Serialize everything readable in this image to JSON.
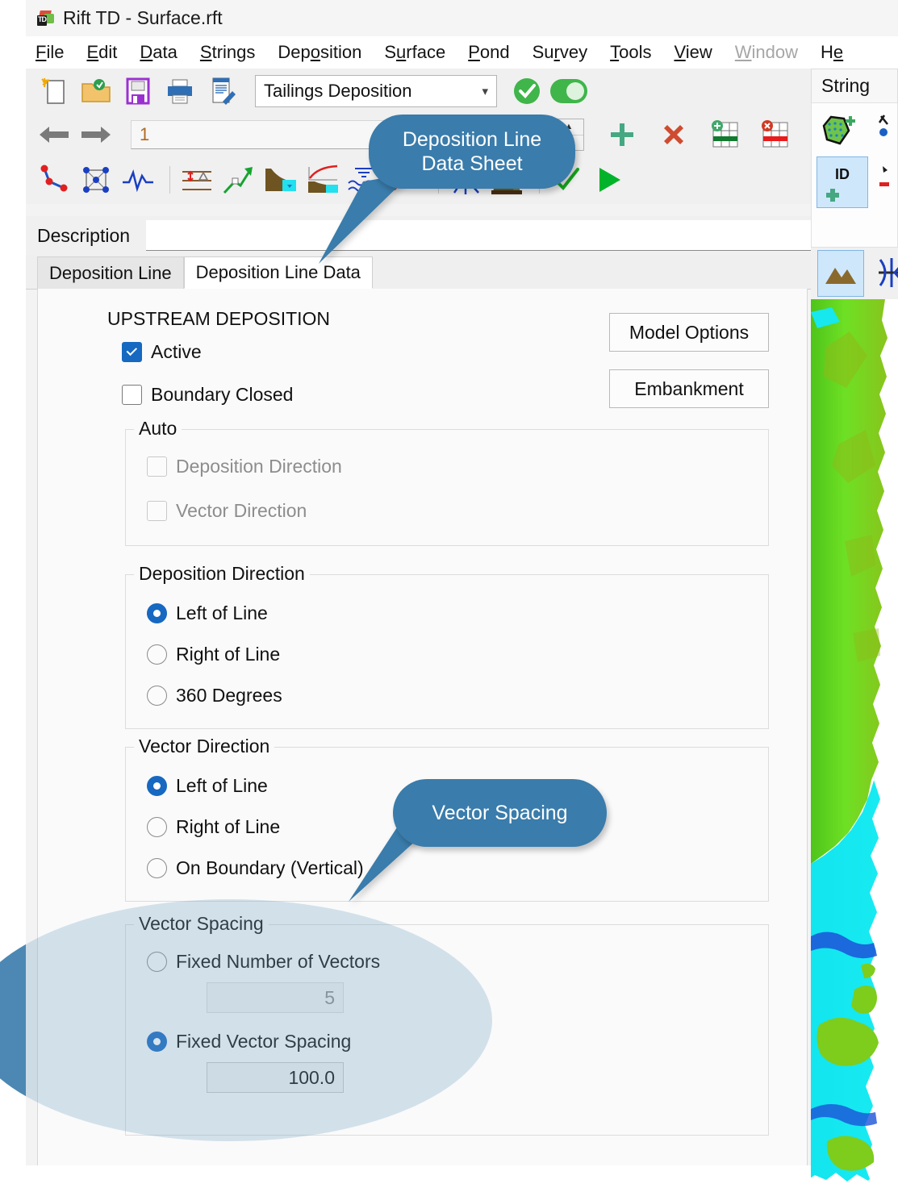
{
  "window": {
    "title": "Rift TD - Surface.rft",
    "icon": "app-icon"
  },
  "menu": [
    {
      "label": "File",
      "accel": "F",
      "disabled": false
    },
    {
      "label": "Edit",
      "accel": "E",
      "disabled": false
    },
    {
      "label": "Data",
      "accel": "D",
      "disabled": false
    },
    {
      "label": "Strings",
      "accel": "S",
      "disabled": false
    },
    {
      "label": "Deposition",
      "accel": "o",
      "disabled": false
    },
    {
      "label": "Surface",
      "accel": "u",
      "disabled": false
    },
    {
      "label": "Pond",
      "accel": "P",
      "disabled": false
    },
    {
      "label": "Survey",
      "accel": "r",
      "disabled": false
    },
    {
      "label": "Tools",
      "accel": "T",
      "disabled": false
    },
    {
      "label": "View",
      "accel": "V",
      "disabled": false
    },
    {
      "label": "Window",
      "accel": "W",
      "disabled": true
    },
    {
      "label": "He",
      "accel": "H",
      "disabled": false
    }
  ],
  "toolbar": {
    "icons_row1": [
      "new-document-icon",
      "open-folder-icon",
      "save-icon",
      "print-icon",
      "edit-notes-icon"
    ],
    "combo": {
      "value": "Tailings Deposition",
      "chevron": "chevron-down-icon"
    },
    "apply_icon": "green-check-circle-icon",
    "toggle_icon": "toggle-on-icon",
    "icons_row2": [
      "back-arrow-icon",
      "forward-arrow-icon"
    ],
    "index_value": "1",
    "spinner_up": "▲",
    "spinner_down": "▼",
    "icons_row2_right": [
      "add-plus-icon",
      "delete-cross-icon",
      "add-row-icon",
      "delete-row-icon"
    ],
    "icons_row3": [
      "polyline-icon",
      "mesh-node-icon",
      "waveform-icon",
      "elevation-delta-icon",
      "green-arrow-up-icon",
      "embankment-fill-icon",
      "curve-profile-icon",
      "water-waves-icon",
      "string-points-icon",
      "axes-cross-icon",
      "embankment-3d-icon",
      "check-icon",
      "play-icon"
    ]
  },
  "description": {
    "label": "Description",
    "value": "",
    "placeholder": ""
  },
  "tabs": [
    {
      "label": "Deposition Line",
      "active": false
    },
    {
      "label": "Deposition Line Data",
      "active": true
    }
  ],
  "panel": {
    "section_title": "UPSTREAM DEPOSITION",
    "checkboxes": [
      {
        "label": "Active",
        "checked": true,
        "disabled": false
      },
      {
        "label": "Boundary Closed",
        "checked": false,
        "disabled": false
      }
    ],
    "buttons": [
      {
        "label": "Model Options"
      },
      {
        "label": "Embankment"
      }
    ],
    "groups": [
      {
        "title": "Auto",
        "type": "checkbox",
        "items": [
          {
            "label": "Deposition Direction",
            "checked": false,
            "disabled": true
          },
          {
            "label": "Vector Direction",
            "checked": false,
            "disabled": true
          }
        ]
      },
      {
        "title": "Deposition Direction",
        "type": "radio",
        "items": [
          {
            "label": "Left of Line",
            "selected": true
          },
          {
            "label": "Right of Line",
            "selected": false
          },
          {
            "label": "360 Degrees",
            "selected": false
          }
        ]
      },
      {
        "title": "Vector Direction",
        "type": "radio",
        "items": [
          {
            "label": "Left of Line",
            "selected": true
          },
          {
            "label": "Right of Line",
            "selected": false
          },
          {
            "label": "On Boundary (Vertical)",
            "selected": false
          }
        ]
      },
      {
        "title": "Vector Spacing",
        "type": "radio-with-input",
        "items": [
          {
            "label": "Fixed Number of Vectors",
            "selected": false,
            "value": "5",
            "input_disabled": true
          },
          {
            "label": "Fixed Vector Spacing",
            "selected": true,
            "value": "100.0",
            "input_disabled": false
          }
        ]
      }
    ]
  },
  "right_dock": {
    "tab_label": "String",
    "icons": [
      {
        "name": "polygon-add-icon",
        "selected": false
      },
      {
        "name": "string-pick-icon",
        "selected": false
      },
      {
        "name": "id-add-icon",
        "selected": true
      },
      {
        "name": "red-marker-icon",
        "selected": false
      },
      {
        "name": "terrain-icon",
        "selected": true
      },
      {
        "name": "axes-cross-icon",
        "selected": false
      }
    ]
  },
  "callouts": [
    {
      "text": "Deposition Line\nData Sheet",
      "line1": "Deposition Line",
      "line2": "Data Sheet"
    },
    {
      "text": "Vector Spacing",
      "line1": "Vector Spacing",
      "line2": ""
    }
  ],
  "colors": {
    "callout_blue": "#3a7cab",
    "accent_blue": "#1668c1",
    "toggle_green": "#3fb54a",
    "terrain_green": "#66dd22",
    "terrain_cyan": "#16e8ee",
    "terrain_deep_blue": "#1c52d8",
    "index_text": "#b06a1f"
  }
}
